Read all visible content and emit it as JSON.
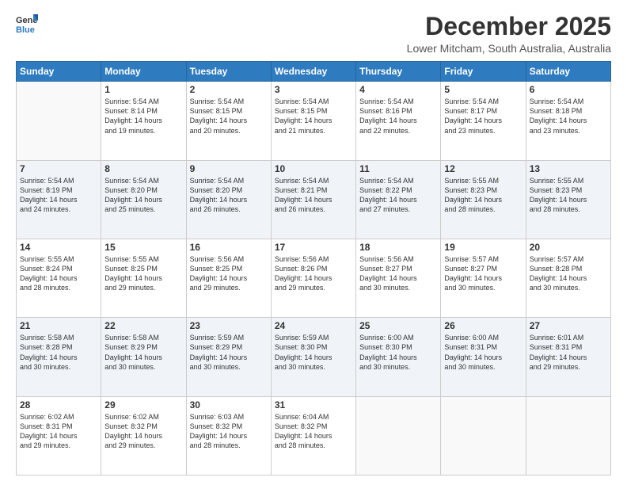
{
  "logo": {
    "line1": "General",
    "line2": "Blue"
  },
  "header": {
    "month": "December 2025",
    "location": "Lower Mitcham, South Australia, Australia"
  },
  "weekdays": [
    "Sunday",
    "Monday",
    "Tuesday",
    "Wednesday",
    "Thursday",
    "Friday",
    "Saturday"
  ],
  "weeks": [
    [
      {
        "day": "",
        "info": ""
      },
      {
        "day": "1",
        "info": "Sunrise: 5:54 AM\nSunset: 8:14 PM\nDaylight: 14 hours\nand 19 minutes."
      },
      {
        "day": "2",
        "info": "Sunrise: 5:54 AM\nSunset: 8:15 PM\nDaylight: 14 hours\nand 20 minutes."
      },
      {
        "day": "3",
        "info": "Sunrise: 5:54 AM\nSunset: 8:15 PM\nDaylight: 14 hours\nand 21 minutes."
      },
      {
        "day": "4",
        "info": "Sunrise: 5:54 AM\nSunset: 8:16 PM\nDaylight: 14 hours\nand 22 minutes."
      },
      {
        "day": "5",
        "info": "Sunrise: 5:54 AM\nSunset: 8:17 PM\nDaylight: 14 hours\nand 23 minutes."
      },
      {
        "day": "6",
        "info": "Sunrise: 5:54 AM\nSunset: 8:18 PM\nDaylight: 14 hours\nand 23 minutes."
      }
    ],
    [
      {
        "day": "7",
        "info": "Sunrise: 5:54 AM\nSunset: 8:19 PM\nDaylight: 14 hours\nand 24 minutes."
      },
      {
        "day": "8",
        "info": "Sunrise: 5:54 AM\nSunset: 8:20 PM\nDaylight: 14 hours\nand 25 minutes."
      },
      {
        "day": "9",
        "info": "Sunrise: 5:54 AM\nSunset: 8:20 PM\nDaylight: 14 hours\nand 26 minutes."
      },
      {
        "day": "10",
        "info": "Sunrise: 5:54 AM\nSunset: 8:21 PM\nDaylight: 14 hours\nand 26 minutes."
      },
      {
        "day": "11",
        "info": "Sunrise: 5:54 AM\nSunset: 8:22 PM\nDaylight: 14 hours\nand 27 minutes."
      },
      {
        "day": "12",
        "info": "Sunrise: 5:55 AM\nSunset: 8:23 PM\nDaylight: 14 hours\nand 28 minutes."
      },
      {
        "day": "13",
        "info": "Sunrise: 5:55 AM\nSunset: 8:23 PM\nDaylight: 14 hours\nand 28 minutes."
      }
    ],
    [
      {
        "day": "14",
        "info": "Sunrise: 5:55 AM\nSunset: 8:24 PM\nDaylight: 14 hours\nand 28 minutes."
      },
      {
        "day": "15",
        "info": "Sunrise: 5:55 AM\nSunset: 8:25 PM\nDaylight: 14 hours\nand 29 minutes."
      },
      {
        "day": "16",
        "info": "Sunrise: 5:56 AM\nSunset: 8:25 PM\nDaylight: 14 hours\nand 29 minutes."
      },
      {
        "day": "17",
        "info": "Sunrise: 5:56 AM\nSunset: 8:26 PM\nDaylight: 14 hours\nand 29 minutes."
      },
      {
        "day": "18",
        "info": "Sunrise: 5:56 AM\nSunset: 8:27 PM\nDaylight: 14 hours\nand 30 minutes."
      },
      {
        "day": "19",
        "info": "Sunrise: 5:57 AM\nSunset: 8:27 PM\nDaylight: 14 hours\nand 30 minutes."
      },
      {
        "day": "20",
        "info": "Sunrise: 5:57 AM\nSunset: 8:28 PM\nDaylight: 14 hours\nand 30 minutes."
      }
    ],
    [
      {
        "day": "21",
        "info": "Sunrise: 5:58 AM\nSunset: 8:28 PM\nDaylight: 14 hours\nand 30 minutes."
      },
      {
        "day": "22",
        "info": "Sunrise: 5:58 AM\nSunset: 8:29 PM\nDaylight: 14 hours\nand 30 minutes."
      },
      {
        "day": "23",
        "info": "Sunrise: 5:59 AM\nSunset: 8:29 PM\nDaylight: 14 hours\nand 30 minutes."
      },
      {
        "day": "24",
        "info": "Sunrise: 5:59 AM\nSunset: 8:30 PM\nDaylight: 14 hours\nand 30 minutes."
      },
      {
        "day": "25",
        "info": "Sunrise: 6:00 AM\nSunset: 8:30 PM\nDaylight: 14 hours\nand 30 minutes."
      },
      {
        "day": "26",
        "info": "Sunrise: 6:00 AM\nSunset: 8:31 PM\nDaylight: 14 hours\nand 30 minutes."
      },
      {
        "day": "27",
        "info": "Sunrise: 6:01 AM\nSunset: 8:31 PM\nDaylight: 14 hours\nand 29 minutes."
      }
    ],
    [
      {
        "day": "28",
        "info": "Sunrise: 6:02 AM\nSunset: 8:31 PM\nDaylight: 14 hours\nand 29 minutes."
      },
      {
        "day": "29",
        "info": "Sunrise: 6:02 AM\nSunset: 8:32 PM\nDaylight: 14 hours\nand 29 minutes."
      },
      {
        "day": "30",
        "info": "Sunrise: 6:03 AM\nSunset: 8:32 PM\nDaylight: 14 hours\nand 28 minutes."
      },
      {
        "day": "31",
        "info": "Sunrise: 6:04 AM\nSunset: 8:32 PM\nDaylight: 14 hours\nand 28 minutes."
      },
      {
        "day": "",
        "info": ""
      },
      {
        "day": "",
        "info": ""
      },
      {
        "day": "",
        "info": ""
      }
    ]
  ]
}
